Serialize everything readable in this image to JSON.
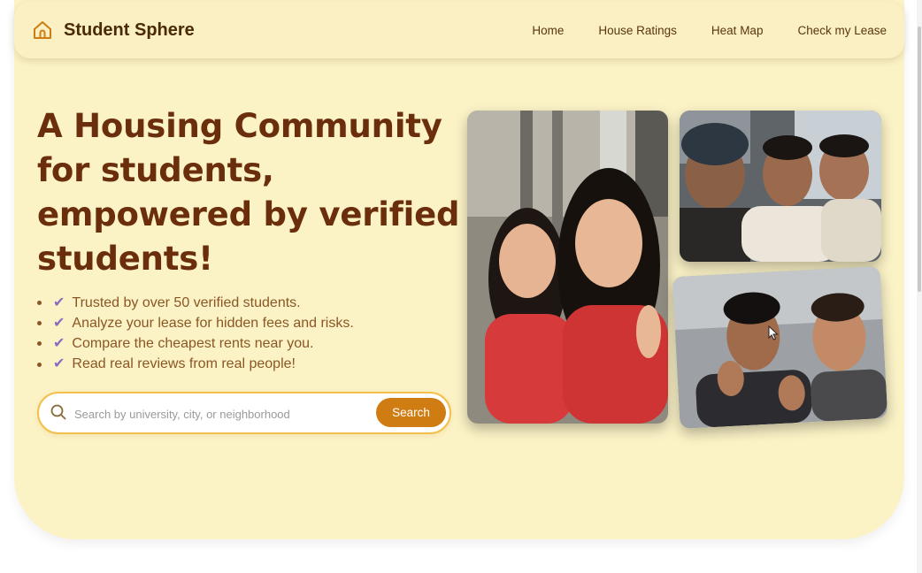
{
  "brand": {
    "name": "Student Sphere",
    "icon": "home-icon"
  },
  "nav": {
    "links": [
      "Home",
      "House Ratings",
      "Heat Map",
      "Check my Lease"
    ]
  },
  "hero": {
    "headline": "A Housing Community for students, empowered by verified students!",
    "features": [
      "Trusted by over 50 verified students.",
      "Analyze your lease for hidden fees and risks.",
      "Compare the cheapest rents near you.",
      "Read real reviews from real people!"
    ],
    "feature_icon": "check-icon"
  },
  "search": {
    "placeholder": "Search by university, city, or neighborhood",
    "value": "",
    "button_label": "Search",
    "icon": "search-icon"
  },
  "colors": {
    "background": "#fbf2c6",
    "headline": "#6b2e0d",
    "accent": "#cf7d12",
    "check": "#8b6bc2",
    "search_border": "#f2c04a"
  }
}
